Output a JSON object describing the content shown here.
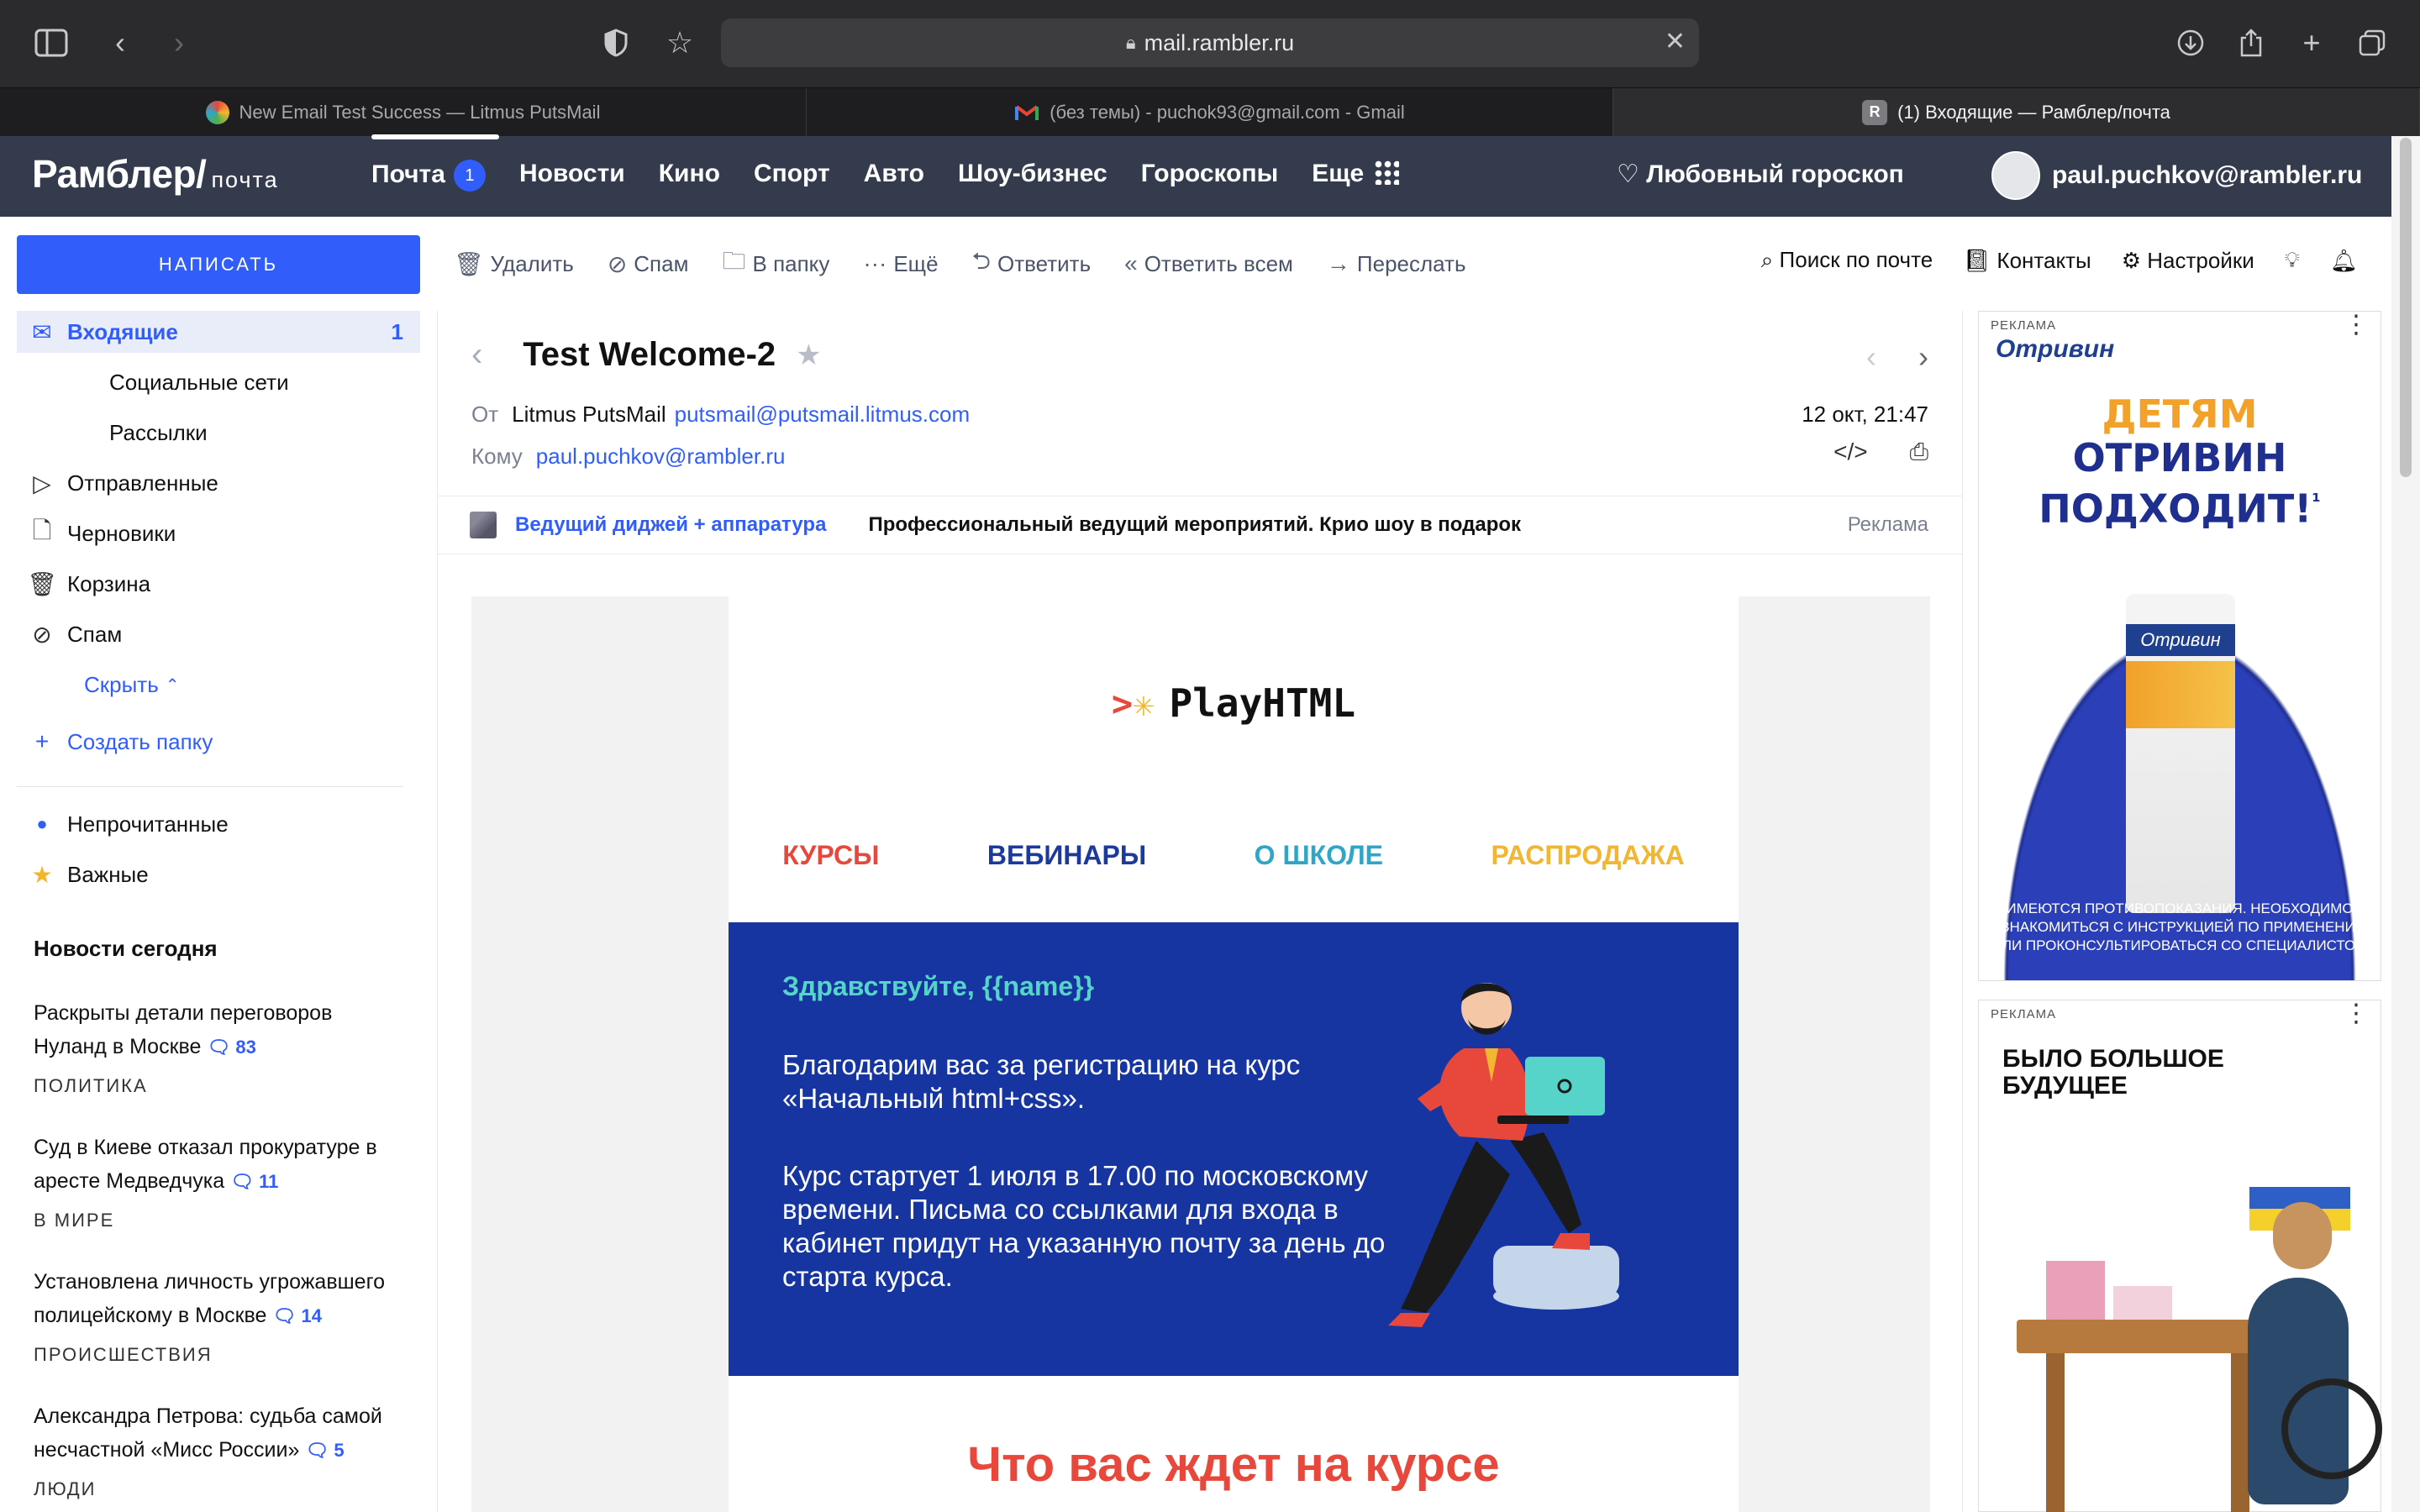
{
  "browser": {
    "url": "mail.rambler.ru",
    "tabs": [
      {
        "title": "New Email Test Success — Litmus PutsMail",
        "icon": "litmus-favicon"
      },
      {
        "title": "(без темы) - puchok93@gmail.com - Gmail",
        "icon": "gmail-favicon"
      },
      {
        "title": "(1) Входящие — Рамблер/почта",
        "icon": "rambler-favicon",
        "favicon_letter": "R",
        "active": true
      }
    ]
  },
  "header": {
    "logo": "Рамблер/",
    "logo_sub": "почта",
    "nav": [
      {
        "label": "Почта",
        "badge": "1"
      },
      {
        "label": "Новости"
      },
      {
        "label": "Кино"
      },
      {
        "label": "Спорт"
      },
      {
        "label": "Авто"
      },
      {
        "label": "Шоу-бизнес"
      },
      {
        "label": "Гороскопы"
      },
      {
        "label": "Еще"
      }
    ],
    "horoscope": "Любовный гороскоп",
    "user_email": "paul.puchkov@rambler.ru"
  },
  "sidebar": {
    "compose": "НАПИСАТЬ",
    "folders": [
      {
        "label": "Входящие",
        "count": "1",
        "icon": "inbox-icon",
        "active": true
      },
      {
        "label": "Социальные сети",
        "sub": true
      },
      {
        "label": "Рассылки",
        "sub": true
      },
      {
        "label": "Отправленные",
        "icon": "sent-icon"
      },
      {
        "label": "Черновики",
        "icon": "drafts-icon"
      },
      {
        "label": "Корзина",
        "icon": "trash-icon"
      },
      {
        "label": "Спам",
        "icon": "spam-icon"
      }
    ],
    "hide": "Скрыть",
    "create_folder": "Создать папку",
    "filters": [
      {
        "label": "Непрочитанные",
        "icon": "unread-dot-icon"
      },
      {
        "label": "Важные",
        "icon": "star-icon"
      }
    ],
    "news_title": "Новости сегодня",
    "news": [
      {
        "text": "Раскрыты детали переговоров Нуланд в Москве",
        "comments": "83",
        "category": "ПОЛИТИКА"
      },
      {
        "text": "Суд в Киеве отказал прокуратуре в аресте Медведчука",
        "comments": "11",
        "category": "В МИРЕ"
      },
      {
        "text": "Установлена личность угрожавшего полицейскому в Москве",
        "comments": "14",
        "category": "ПРОИСШЕСТВИЯ"
      },
      {
        "text": "Александра Петрова: судьба самой несчастной «Мисс России»",
        "comments": "5",
        "category": "ЛЮДИ"
      }
    ]
  },
  "actions": {
    "delete": "Удалить",
    "spam": "Спам",
    "to_folder": "В папку",
    "more": "Ещё",
    "reply": "Ответить",
    "reply_all": "Ответить всем",
    "forward": "Переслать",
    "search": "Поиск по почте",
    "contacts": "Контакты",
    "settings": "Настройки"
  },
  "letter": {
    "subject": "Test Welcome-2",
    "from_label": "От",
    "from_name": "Litmus PutsMail",
    "from_email": "putsmail@putsmail.litmus.com",
    "to_label": "Кому",
    "to_email": "paul.puchkov@rambler.ru",
    "date": "12 окт, 21:47",
    "ad": {
      "link": "Ведущий диджей + аппаратура",
      "text": "Профессиональный ведущий мероприятий. Крио шоу в подарок",
      "label": "Реклама"
    },
    "email": {
      "brand": "PlayHTML",
      "nav": [
        {
          "label": "КУРСЫ",
          "color": "#e8483b"
        },
        {
          "label": "ВЕБИНАРЫ",
          "color": "#1b3a9c"
        },
        {
          "label": "О ШКОЛЕ",
          "color": "#2fa6c8"
        },
        {
          "label": "РАСПРОДАЖА",
          "color": "#f2b632"
        }
      ],
      "greeting": "Здравствуйте, {{name}}",
      "p1": "Благодарим вас за регистрацию на курс «Начальный html+css».",
      "p2": "Курс стартует 1 июля в 17.00 по московскому времени. Письма со ссылками для входа в кабинет придут на указанную почту за день до старта курса.",
      "section_title": "Что вас ждет на курсе"
    }
  },
  "ads": [
    {
      "label": "РЕКЛАМА",
      "brand": "Отривин",
      "headline_1": "ДЕТЯМ",
      "headline_2": "ОТРИВИН",
      "headline_3": "ПОДХОДИТ!",
      "footnote": "¹",
      "product": "Отривин",
      "disclaimer": "ИМЕЮТСЯ ПРОТИВОПОКАЗАНИЯ. НЕОБХОДИМО ОЗНАКОМИТЬСЯ С ИНСТРУКЦИЕЙ ПО ПРИМЕНЕНИЮ ИЛИ ПРОКОНСУЛЬТИРОВАТЬСЯ СО СПЕЦИАЛИСТОМ"
    },
    {
      "label": "РЕКЛАМА",
      "headline": "БЫЛО БОЛЬШОЕ БУДУЩЕЕ"
    }
  ],
  "colors": {
    "accent": "#315efb",
    "header_bg": "#343b4c",
    "hero_bg": "#1635a0"
  }
}
